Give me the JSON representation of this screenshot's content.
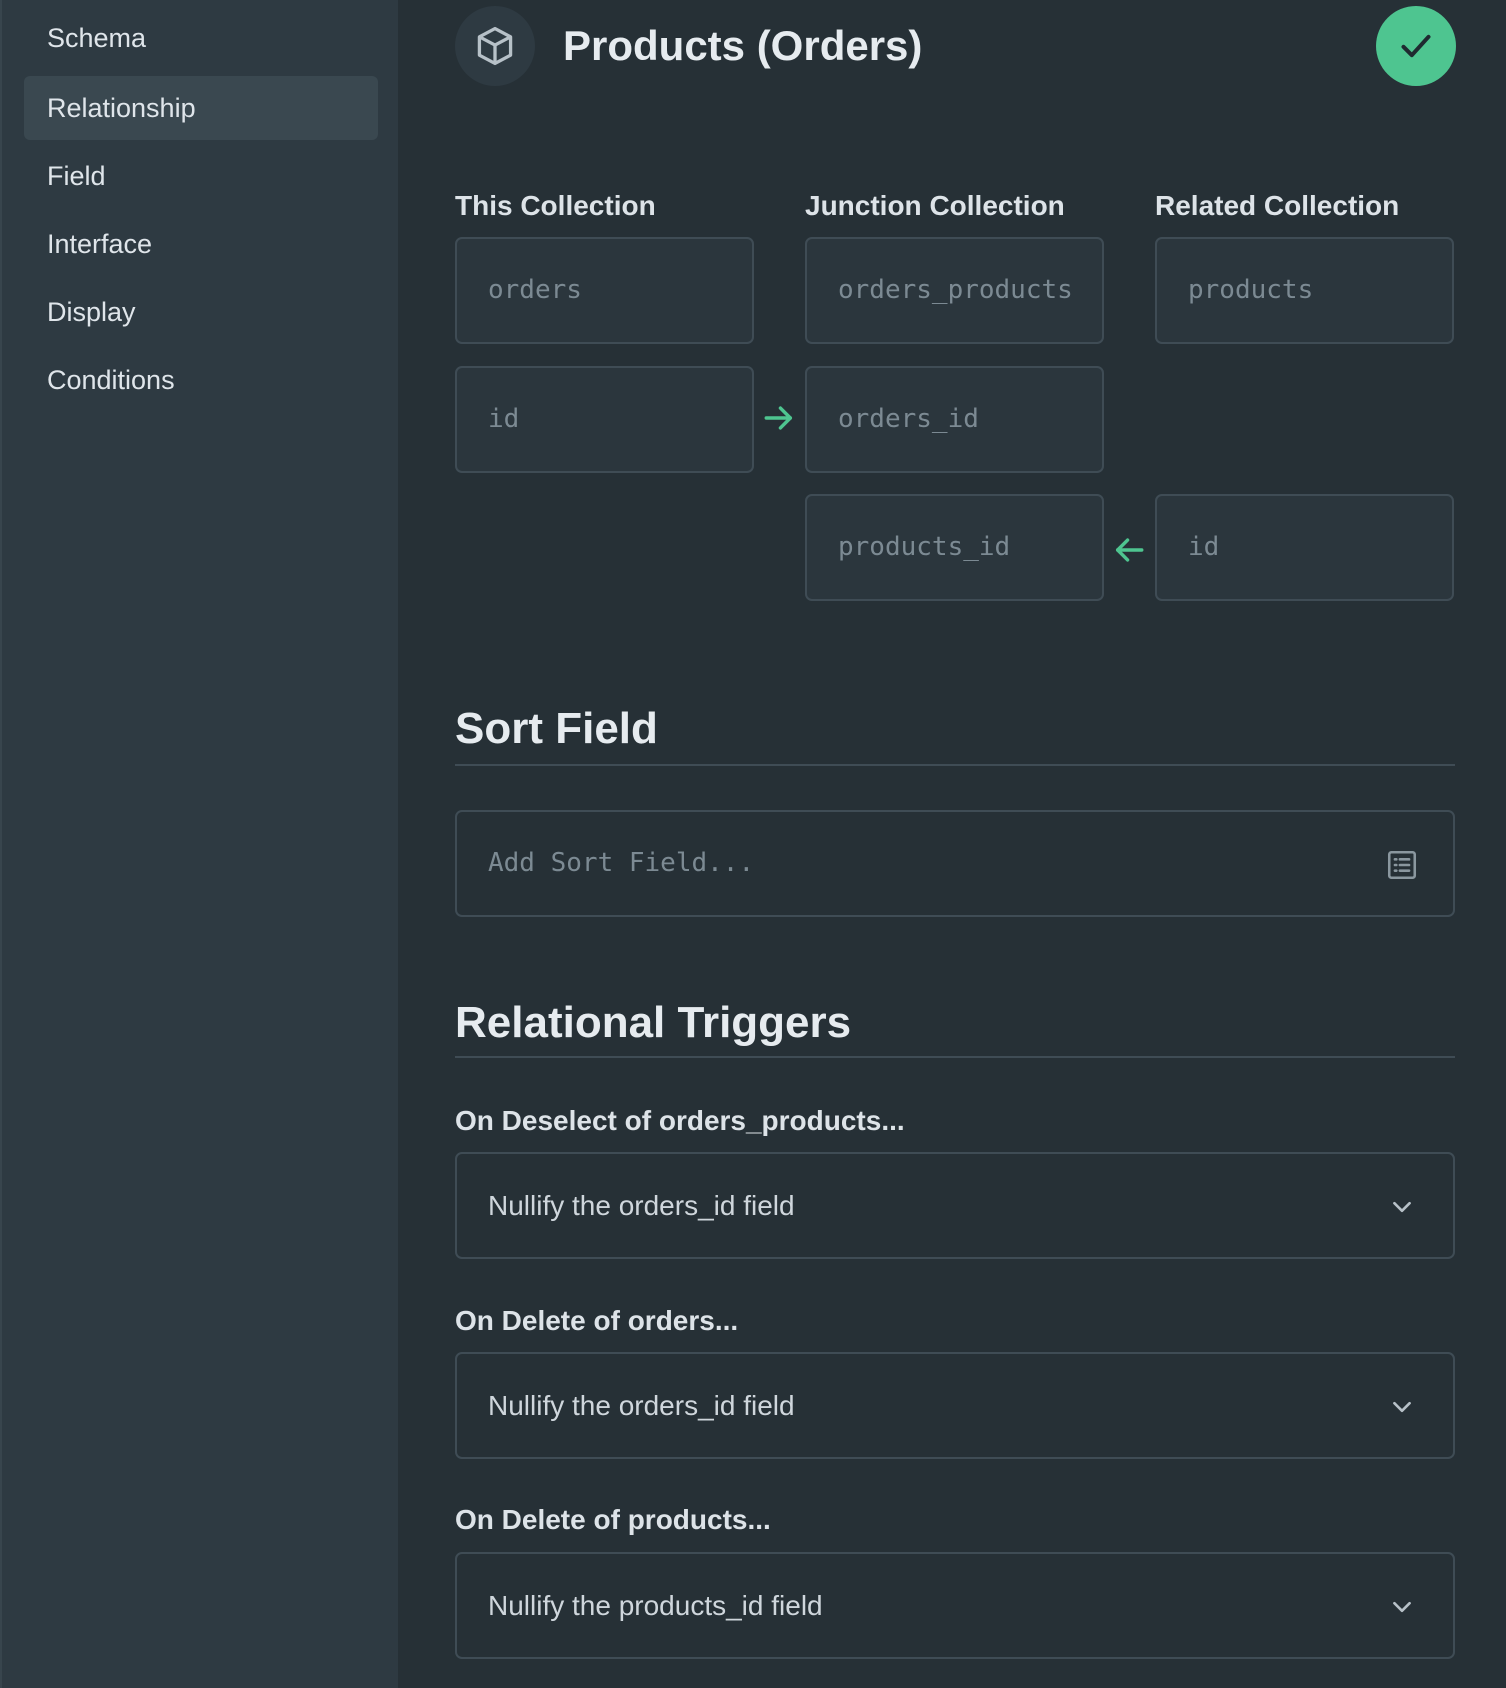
{
  "sidebar": {
    "items": [
      {
        "label": "Schema",
        "active": false
      },
      {
        "label": "Relationship",
        "active": true
      },
      {
        "label": "Field",
        "active": false
      },
      {
        "label": "Interface",
        "active": false
      },
      {
        "label": "Display",
        "active": false
      },
      {
        "label": "Conditions",
        "active": false
      }
    ]
  },
  "header": {
    "title": "Products (Orders)",
    "icon": "box-icon",
    "save_icon": "check-icon"
  },
  "relationship": {
    "columns": [
      "This Collection",
      "Junction Collection",
      "Related Collection"
    ],
    "this_collection": "orders",
    "junction_collection": "orders_products",
    "related_collection": "products",
    "this_field": "id",
    "junction_field_this": "orders_id",
    "junction_field_related": "products_id",
    "related_field": "id"
  },
  "sort_field": {
    "title": "Sort Field",
    "placeholder": "Add Sort Field..."
  },
  "triggers": {
    "title": "Relational Triggers",
    "items": [
      {
        "label": "On Deselect of orders_products...",
        "value": "Nullify the orders_id field"
      },
      {
        "label": "On Delete of orders...",
        "value": "Nullify the orders_id field"
      },
      {
        "label": "On Delete of products...",
        "value": "Nullify the products_id field"
      }
    ]
  },
  "colors": {
    "accent": "#4ec590",
    "background": "#263036",
    "sidebar": "#2e3a42",
    "border": "#3f4c55"
  }
}
